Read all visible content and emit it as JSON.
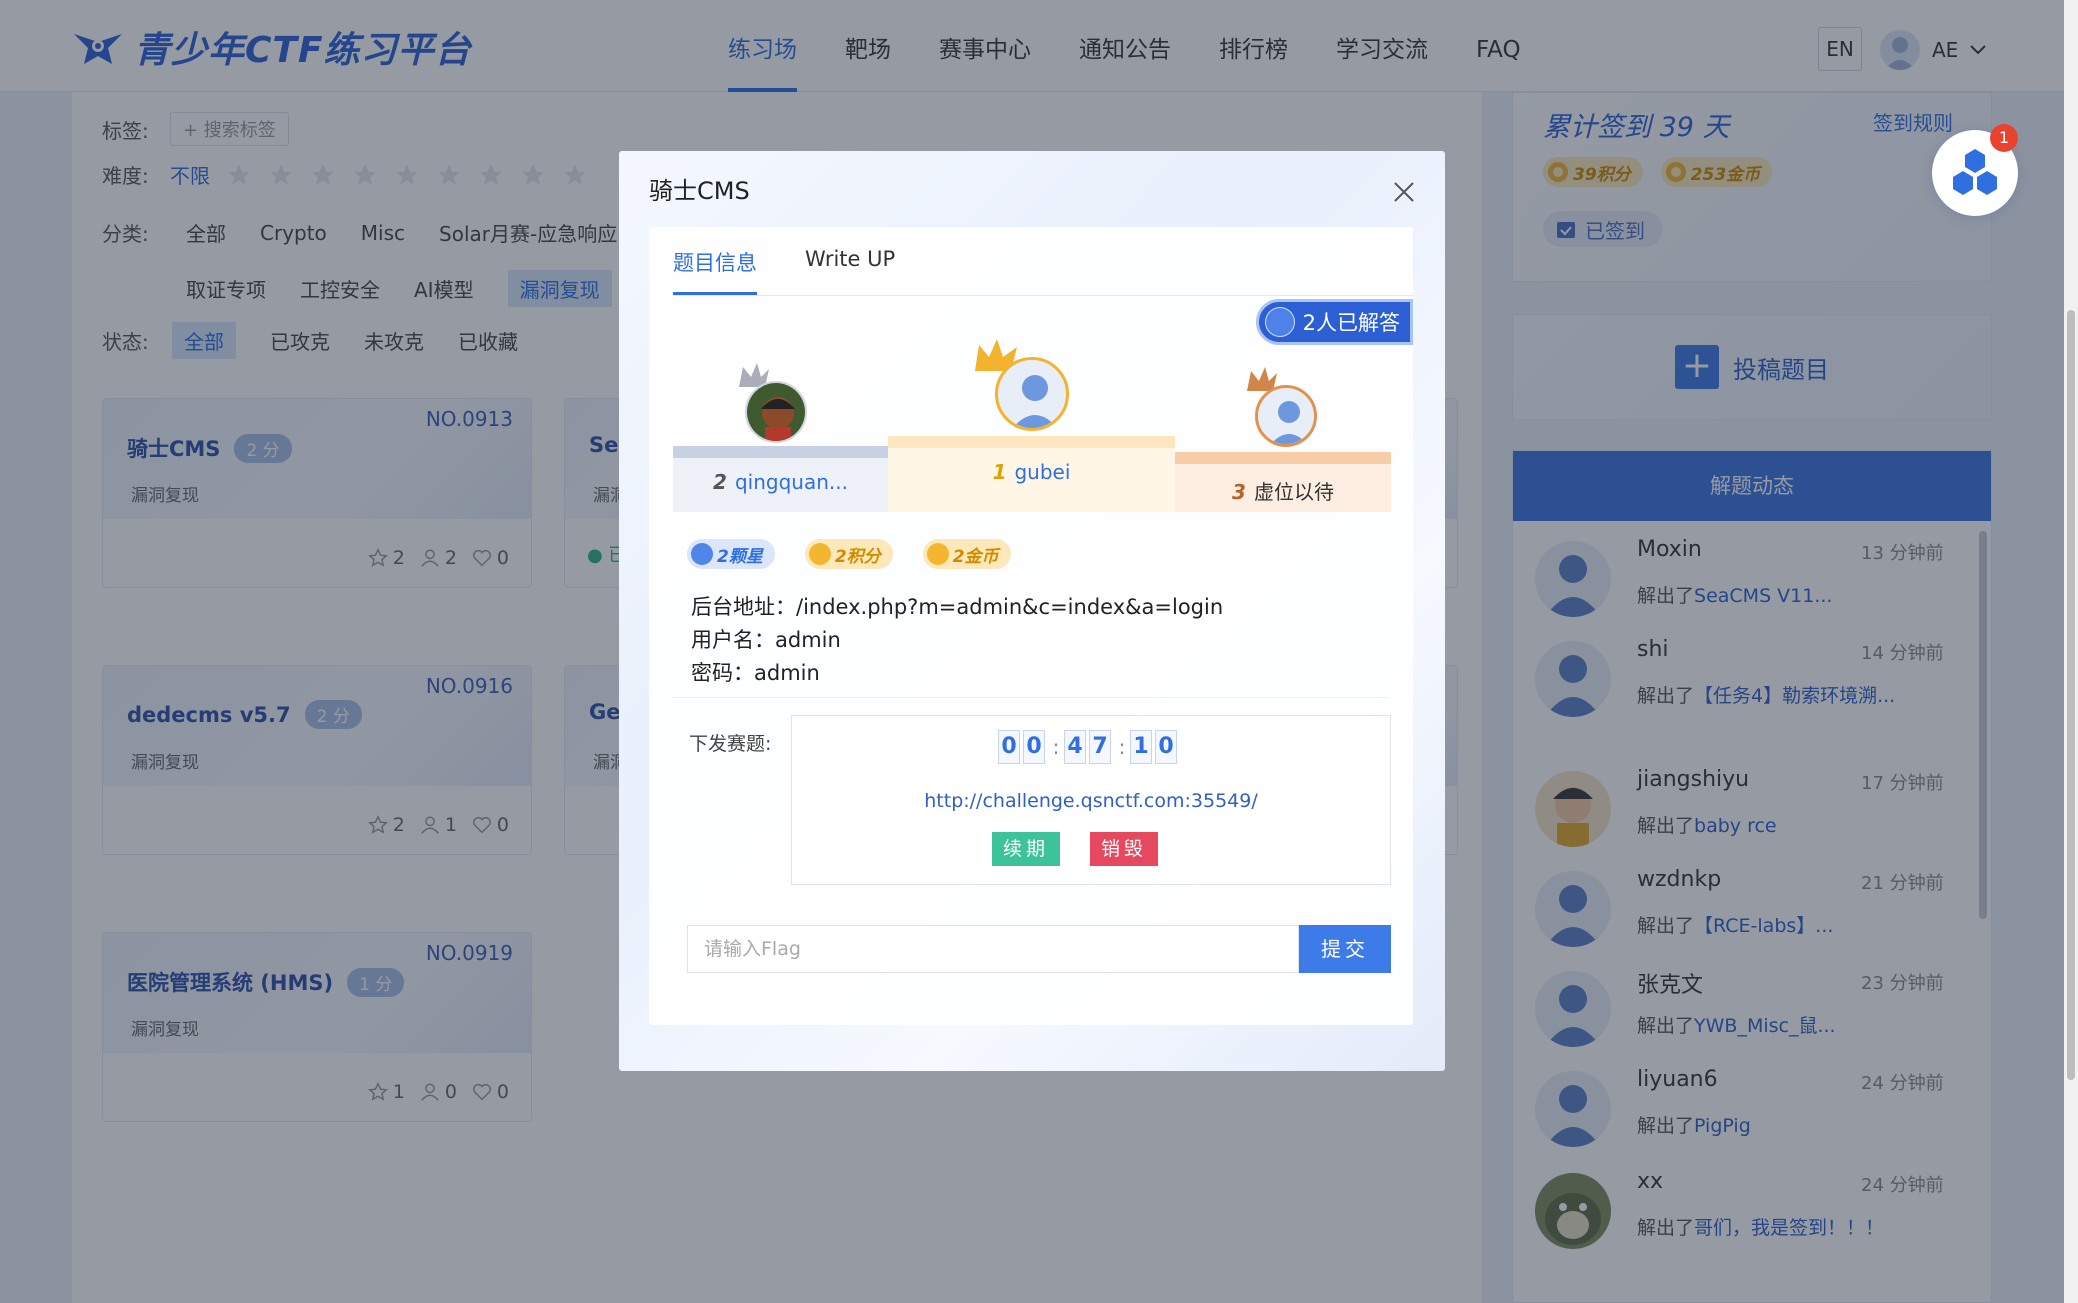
{
  "header": {
    "logo_text": "青少年CTF练习平台",
    "nav": [
      "练习场",
      "靶场",
      "赛事中心",
      "通知公告",
      "排行榜",
      "学习交流",
      "FAQ"
    ],
    "lang": "EN",
    "user": "AE"
  },
  "filters": {
    "tag_label": "标签:",
    "tag_search": "+ 搜索标签",
    "difficulty_label": "难度:",
    "difficulty_value": "不限",
    "category_label": "分类:",
    "categories_row1": [
      "全部",
      "Crypto",
      "Misc",
      "Solar月赛-应急响应"
    ],
    "categories_row2": [
      "取证专项",
      "工控安全",
      "AI模型",
      "漏洞复现"
    ],
    "status_label": "状态:",
    "statuses": [
      "全部",
      "已攻克",
      "未攻克",
      "已收藏"
    ]
  },
  "cards": [
    {
      "no": "NO.0913",
      "name": "骑士CMS",
      "points": "2 分",
      "category": "漏洞复现",
      "stars": "2",
      "solvers": "2",
      "likes": "0"
    },
    {
      "no": "NO.0916",
      "name": "dedecms v5.7",
      "points": "2 分",
      "category": "漏洞复现",
      "stars": "2",
      "solvers": "1",
      "likes": "0"
    },
    {
      "no": "NO.0919",
      "name": "医院管理系统 (HMS)",
      "points": "1 分",
      "category": "漏洞复现",
      "stars": "1",
      "solvers": "0",
      "likes": "0"
    }
  ],
  "partial_cards": [
    {
      "name": "Sea",
      "category": "漏洞",
      "status": "● 已"
    },
    {
      "name": "Get",
      "category": "漏洞"
    }
  ],
  "signin": {
    "title": "累计签到 39 天",
    "rule": "签到规则",
    "points": "39积分",
    "coins": "253金币",
    "signed": "已签到",
    "notif_count": "1"
  },
  "submit_card": {
    "label": "投稿题目"
  },
  "feed": {
    "title": "解题动态",
    "items": [
      {
        "name": "Moxin",
        "time": "13 分钟前",
        "action": "解出了",
        "title": "SeaCMS V11..."
      },
      {
        "name": "shi",
        "time": "14 分钟前",
        "action": "解出了",
        "title": "【任务4】勒索环境溯..."
      },
      {
        "name": "jiangshiyu",
        "time": "17 分钟前",
        "action": "解出了",
        "title": "baby rce"
      },
      {
        "name": "wzdnkp",
        "time": "21 分钟前",
        "action": "解出了",
        "title": "【RCE-labs】..."
      },
      {
        "name": "张克文",
        "time": "23 分钟前",
        "action": "解出了",
        "title": "YWB_Misc_鼠..."
      },
      {
        "name": "liyuan6",
        "time": "24 分钟前",
        "action": "解出了",
        "title": "PigPig"
      },
      {
        "name": "xx",
        "time": "24 分钟前",
        "action": "解出了",
        "title": "哥们，我是签到！！！"
      }
    ]
  },
  "modal": {
    "title": "骑士CMS",
    "tabs": [
      "题目信息",
      "Write UP"
    ],
    "solved": "2人已解答",
    "podium": {
      "first": {
        "rank": "1",
        "name": "gubei"
      },
      "second": {
        "rank": "2",
        "name": "qingquan..."
      },
      "third": {
        "rank": "3",
        "name": "虚位以待"
      }
    },
    "rewards": [
      "2颗星",
      "2积分",
      "2金币"
    ],
    "desc_lines": [
      "后台地址：/index.php?m=admin&c=index&a=login",
      "用户名：admin",
      "密码：admin"
    ],
    "deploy_label": "下发赛题:",
    "timer": [
      "0",
      "0",
      "4",
      "7",
      "1",
      "0"
    ],
    "url": "http://challenge.qsnctf.com:35549/",
    "renew": "续期",
    "destroy": "销毁",
    "flag_placeholder": "请输入Flag",
    "submit": "提交"
  }
}
